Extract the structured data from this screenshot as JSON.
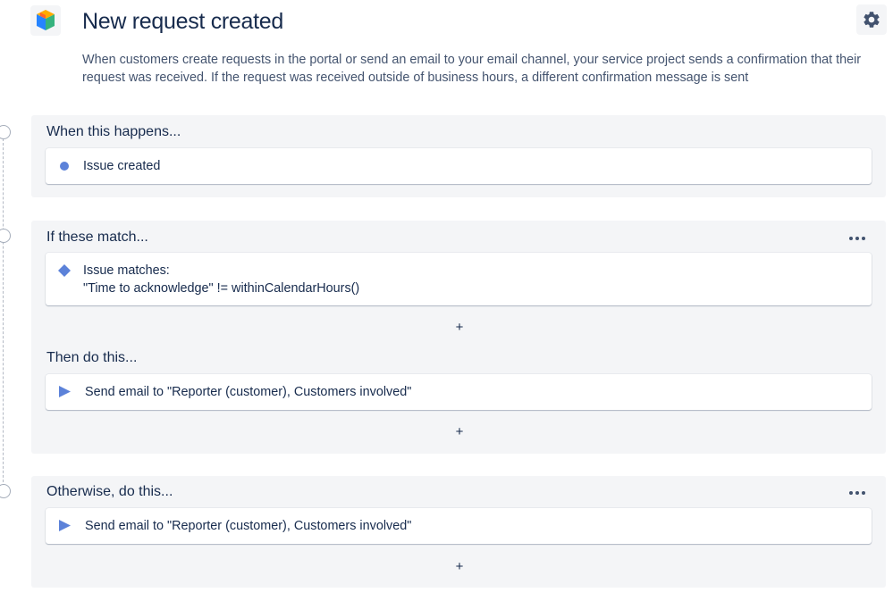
{
  "header": {
    "title": "New request created",
    "description": "When customers create requests in the portal or send an email to your email channel, your service project sends a confirmation that their request was received. If the request was received outside of business hours, a different confirmation message is sent",
    "logo_icon": "service-project-cube-icon",
    "settings_icon": "gear-icon"
  },
  "trigger": {
    "title": "When this happens...",
    "item": {
      "icon": "circle-icon",
      "label": "Issue created",
      "color": "#5c82d9"
    }
  },
  "condition": {
    "title": "If these match...",
    "more_icon": "more-icon",
    "item": {
      "icon": "diamond-icon",
      "label_line1": "Issue matches:",
      "label_line2": "\"Time to acknowledge\" != withinCalendarHours()",
      "color": "#5c82d9"
    },
    "add_label": "+",
    "then_title": "Then do this...",
    "action": {
      "icon": "play-icon",
      "label": "Send email to \"Reporter (customer), Customers involved\"",
      "color": "#5c82d9"
    },
    "then_add_label": "+"
  },
  "otherwise": {
    "title": "Otherwise, do this...",
    "more_icon": "more-icon",
    "action": {
      "icon": "play-icon",
      "label": "Send email to \"Reporter (customer), Customers involved\"",
      "color": "#5c82d9"
    },
    "add_label": "+"
  }
}
